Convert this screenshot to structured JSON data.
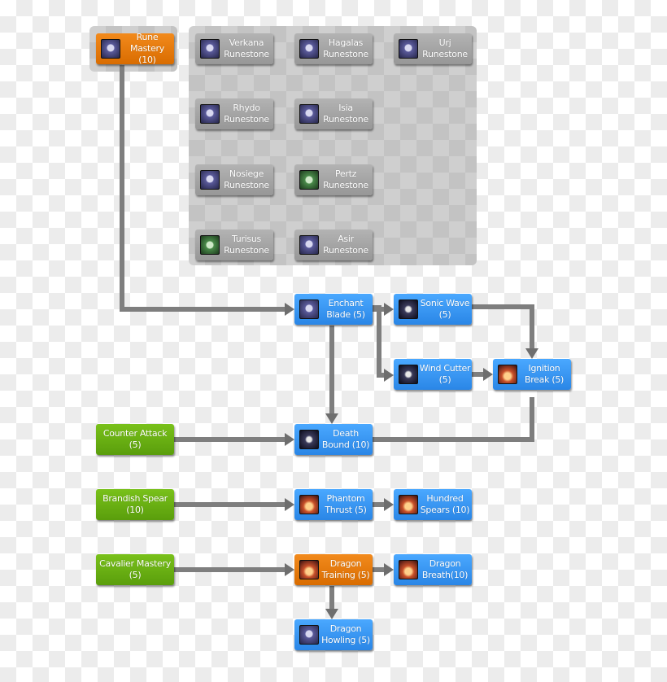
{
  "nodes": {
    "rune_mastery": {
      "label": "Rune Mastery (10)",
      "color": "orange",
      "icon": "rune-icon"
    },
    "verkana": {
      "label": "Verkana Runestone",
      "color": "gray",
      "icon": "runestone-icon"
    },
    "hagalas": {
      "label": "Hagalas Runestone",
      "color": "gray",
      "icon": "runestone-icon"
    },
    "urj": {
      "label": "Urj Runestone",
      "color": "gray",
      "icon": "runestone-icon"
    },
    "rhydo": {
      "label": "Rhydo Runestone",
      "color": "gray",
      "icon": "runestone-icon"
    },
    "isia": {
      "label": "Isia Runestone",
      "color": "gray",
      "icon": "runestone-icon"
    },
    "nosiege": {
      "label": "Nosiege Runestone",
      "color": "gray",
      "icon": "runestone-icon"
    },
    "pertz": {
      "label": "Pertz Runestone",
      "color": "gray",
      "icon": "runestone-icon"
    },
    "turisus": {
      "label": "Turisus Runestone",
      "color": "gray",
      "icon": "runestone-icon"
    },
    "asir": {
      "label": "Asir Runestone",
      "color": "gray",
      "icon": "runestone-icon"
    },
    "enchant_blade": {
      "label": "Enchant Blade (5)",
      "color": "blue",
      "icon": "blade-icon"
    },
    "sonic_wave": {
      "label": "Sonic Wave (5)",
      "color": "blue",
      "icon": "wave-icon"
    },
    "wind_cutter": {
      "label": "Wind Cutter (5)",
      "color": "blue",
      "icon": "wind-icon"
    },
    "ignition_break": {
      "label": "Ignition Break (5)",
      "color": "blue",
      "icon": "fire-icon"
    },
    "death_bound": {
      "label": "Death Bound (10)",
      "color": "blue",
      "icon": "star-icon"
    },
    "counter_attack": {
      "label": "Counter Attack (5)",
      "color": "green"
    },
    "brandish_spear": {
      "label": "Brandish Spear (10)",
      "color": "green"
    },
    "phantom_thrust": {
      "label": "Phantom Thrust (5)",
      "color": "blue",
      "icon": "spear-icon"
    },
    "hundred_spears": {
      "label": "Hundred Spears (10)",
      "color": "blue",
      "icon": "spears-icon"
    },
    "cavalier_mastery": {
      "label": "Cavalier Mastery (5)",
      "color": "green"
    },
    "dragon_training": {
      "label": "Dragon Training (5)",
      "color": "orange",
      "icon": "dragon-icon"
    },
    "dragon_breath": {
      "label": "Dragon Breath(10)",
      "color": "blue",
      "icon": "breath-icon"
    },
    "dragon_howling": {
      "label": "Dragon Howling (5)",
      "color": "blue",
      "icon": "howl-icon"
    }
  }
}
